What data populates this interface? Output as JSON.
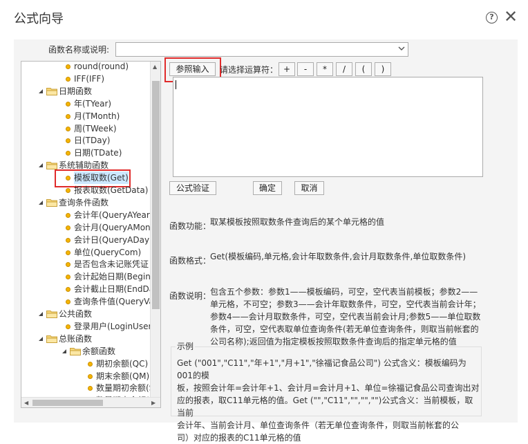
{
  "title": "公式向导",
  "icons": {
    "help": "help-icon",
    "close": "close-icon"
  },
  "function_search": {
    "label": "函数名称或说明:",
    "value": ""
  },
  "tree": {
    "items": [
      {
        "label": "round(round)",
        "type": "leaf",
        "level": 2
      },
      {
        "label": "IFF(IFF)",
        "type": "leaf",
        "level": 2
      },
      {
        "label": "日期函数",
        "type": "folder",
        "level": 1
      },
      {
        "label": "年(TYear)",
        "type": "leaf",
        "level": 2
      },
      {
        "label": "月(TMonth)",
        "type": "leaf",
        "level": 2
      },
      {
        "label": "周(TWeek)",
        "type": "leaf",
        "level": 2
      },
      {
        "label": "日(TDay)",
        "type": "leaf",
        "level": 2
      },
      {
        "label": "日期(TDate)",
        "type": "leaf",
        "level": 2
      },
      {
        "label": "系统辅助函数",
        "type": "folder",
        "level": 1
      },
      {
        "label": "模板取数(Get)",
        "type": "leaf",
        "level": 2,
        "selected": true
      },
      {
        "label": "报表取数(GetData)",
        "type": "leaf",
        "level": 2
      },
      {
        "label": "查询条件函数",
        "type": "folder",
        "level": 1
      },
      {
        "label": "会计年(QueryAYear)",
        "type": "leaf",
        "level": 2
      },
      {
        "label": "会计月(QueryAMonth)",
        "type": "leaf",
        "level": 2
      },
      {
        "label": "会计日(QueryADay)",
        "type": "leaf",
        "level": 2
      },
      {
        "label": "单位(QueryCom)",
        "type": "leaf",
        "level": 2
      },
      {
        "label": "是否包含未记账凭证",
        "type": "leaf",
        "level": 2
      },
      {
        "label": "会计起始日期(BeginDate)",
        "type": "leaf",
        "level": 2
      },
      {
        "label": "会计截止日期(EndDate)",
        "type": "leaf",
        "level": 2
      },
      {
        "label": "查询条件值(QueryValue)",
        "type": "leaf",
        "level": 2
      },
      {
        "label": "公共函数",
        "type": "folder",
        "level": 1
      },
      {
        "label": "登录用户(LoginUser)",
        "type": "leaf",
        "level": 2
      },
      {
        "label": "总账函数",
        "type": "folder",
        "level": 1
      },
      {
        "label": "余额函数",
        "type": "folder",
        "level": 2
      },
      {
        "label": "期初余额(QC)",
        "type": "leaf",
        "level": 3
      },
      {
        "label": "期末余额(QM)",
        "type": "leaf",
        "level": 3
      },
      {
        "label": "数量期初余额(SQC)",
        "type": "leaf",
        "level": 3
      },
      {
        "label": "数量期末余额(SQM)",
        "type": "leaf",
        "level": 3
      }
    ]
  },
  "toolbar": {
    "ref_input": "参照输入",
    "op_label": "请选择运算符：",
    "operators": [
      "+",
      "-",
      "*",
      "/",
      "(",
      ")"
    ]
  },
  "editor_value": "",
  "actions": {
    "validate": "公式验证",
    "ok": "确定",
    "cancel": "取消"
  },
  "info": {
    "func_label": "函数功能：",
    "func_text": "取某模板按照取数条件查询后的某个单元格的值",
    "format_label": "函数格式：",
    "format_text": "Get(模板编码,单元格,会计年取数条件,会计月取数条件,单位取数条件)",
    "desc_label": "函数说明：",
    "desc_lines": [
      "包含五个参数：参数1——模板编码，可空，空代表当前模板；参数2——",
      "单元格，不可空；参数3——会计年取数条件，可空，空代表当前会计年；",
      "参数4——会计月取数条件，可空，空代表当前会计月;参数5——单位取数",
      "条件，可空，空代表取单位查询条件(若无单位查询条件，则取当前帐套的",
      "公司名称);返回值为指定模板按照取数条件查询后的指定单元格的值"
    ]
  },
  "example": {
    "title": "示例",
    "lines": [
      "Get (\"001\",\"C11\",\"年+1\",\"月+1\",\"徐福记食品公司\") 公式含义：模板编码为001的模",
      "板，按照会计年=会计年+1、会计月=会计月+1、单位=徐福记食品公司查询出对",
      "应的报表，取C11单元格的值。Get (\"\",\"C11\",\"\",\"\",\"\")公式含义：当前模板，取当前",
      "会计年、当前会计月、单位查询条件（若无单位查询条件，则取当前帐套的公",
      "司）对应的报表的C11单元格的值"
    ]
  },
  "colors": {
    "highlight": "#e02a2a",
    "folder": "#f2c94c",
    "leaf_dot": "#f5b500"
  }
}
